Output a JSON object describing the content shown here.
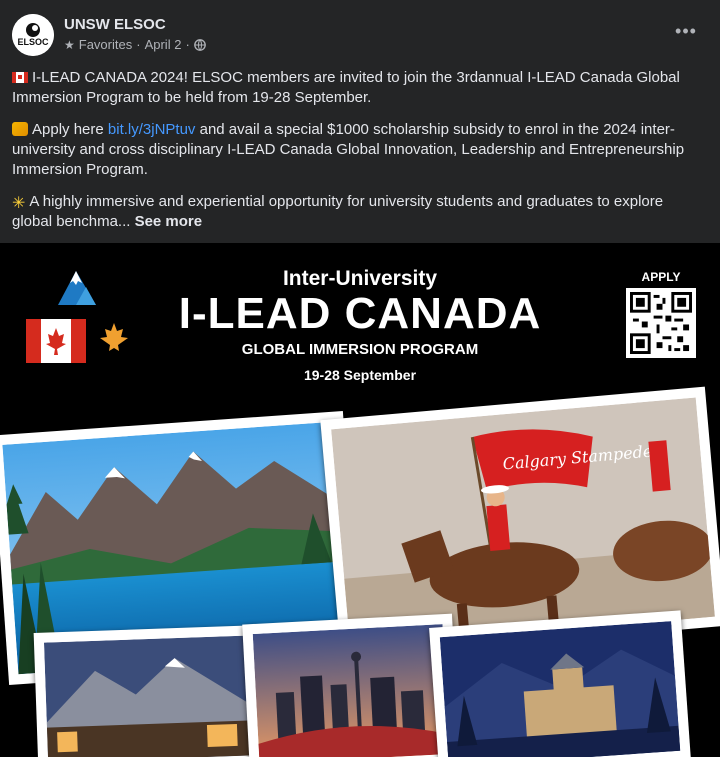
{
  "header": {
    "page_name": "UNSW ELSOC",
    "avatar_text": "ELSOC",
    "favorites": "Favorites",
    "separator": "·",
    "date": "April 2",
    "separator2": "·",
    "more": "•••"
  },
  "post": {
    "p1": "I-LEAD CANADA 2024! ELSOC members are invited to join the 3rdannual I-LEAD Canada Global Immersion Program to be held from 19-28 September.",
    "p2_before": "Apply here ",
    "p2_link": "bit.ly/3jNPtuv",
    "p2_after": " and avail a special $1000 scholarship subsidy to enrol in the 2024 inter-university and cross disciplinary I-LEAD Canada Global Innovation, Leadership and Entrepreneurship Immersion Program.",
    "p3": "A highly immersive and experiential opportunity for university students and graduates to explore global benchma... ",
    "see_more": "See more"
  },
  "image": {
    "title_small": "Inter-University",
    "title_big": "I-LEAD CANADA",
    "subtitle": "GLOBAL IMMERSION PROGRAM",
    "dates": "19-28 September",
    "apply": "APPLY",
    "banner_text": "Calgary Stampede"
  },
  "icons": [
    "star-icon",
    "globe-icon",
    "more-icon",
    "canada-flag-icon",
    "pencil-emoji-icon",
    "sparkle-emoji-icon"
  ],
  "colors": {
    "background": "#242526",
    "text": "#e4e6eb",
    "muted": "#b0b3b8",
    "link": "#4599ff"
  }
}
